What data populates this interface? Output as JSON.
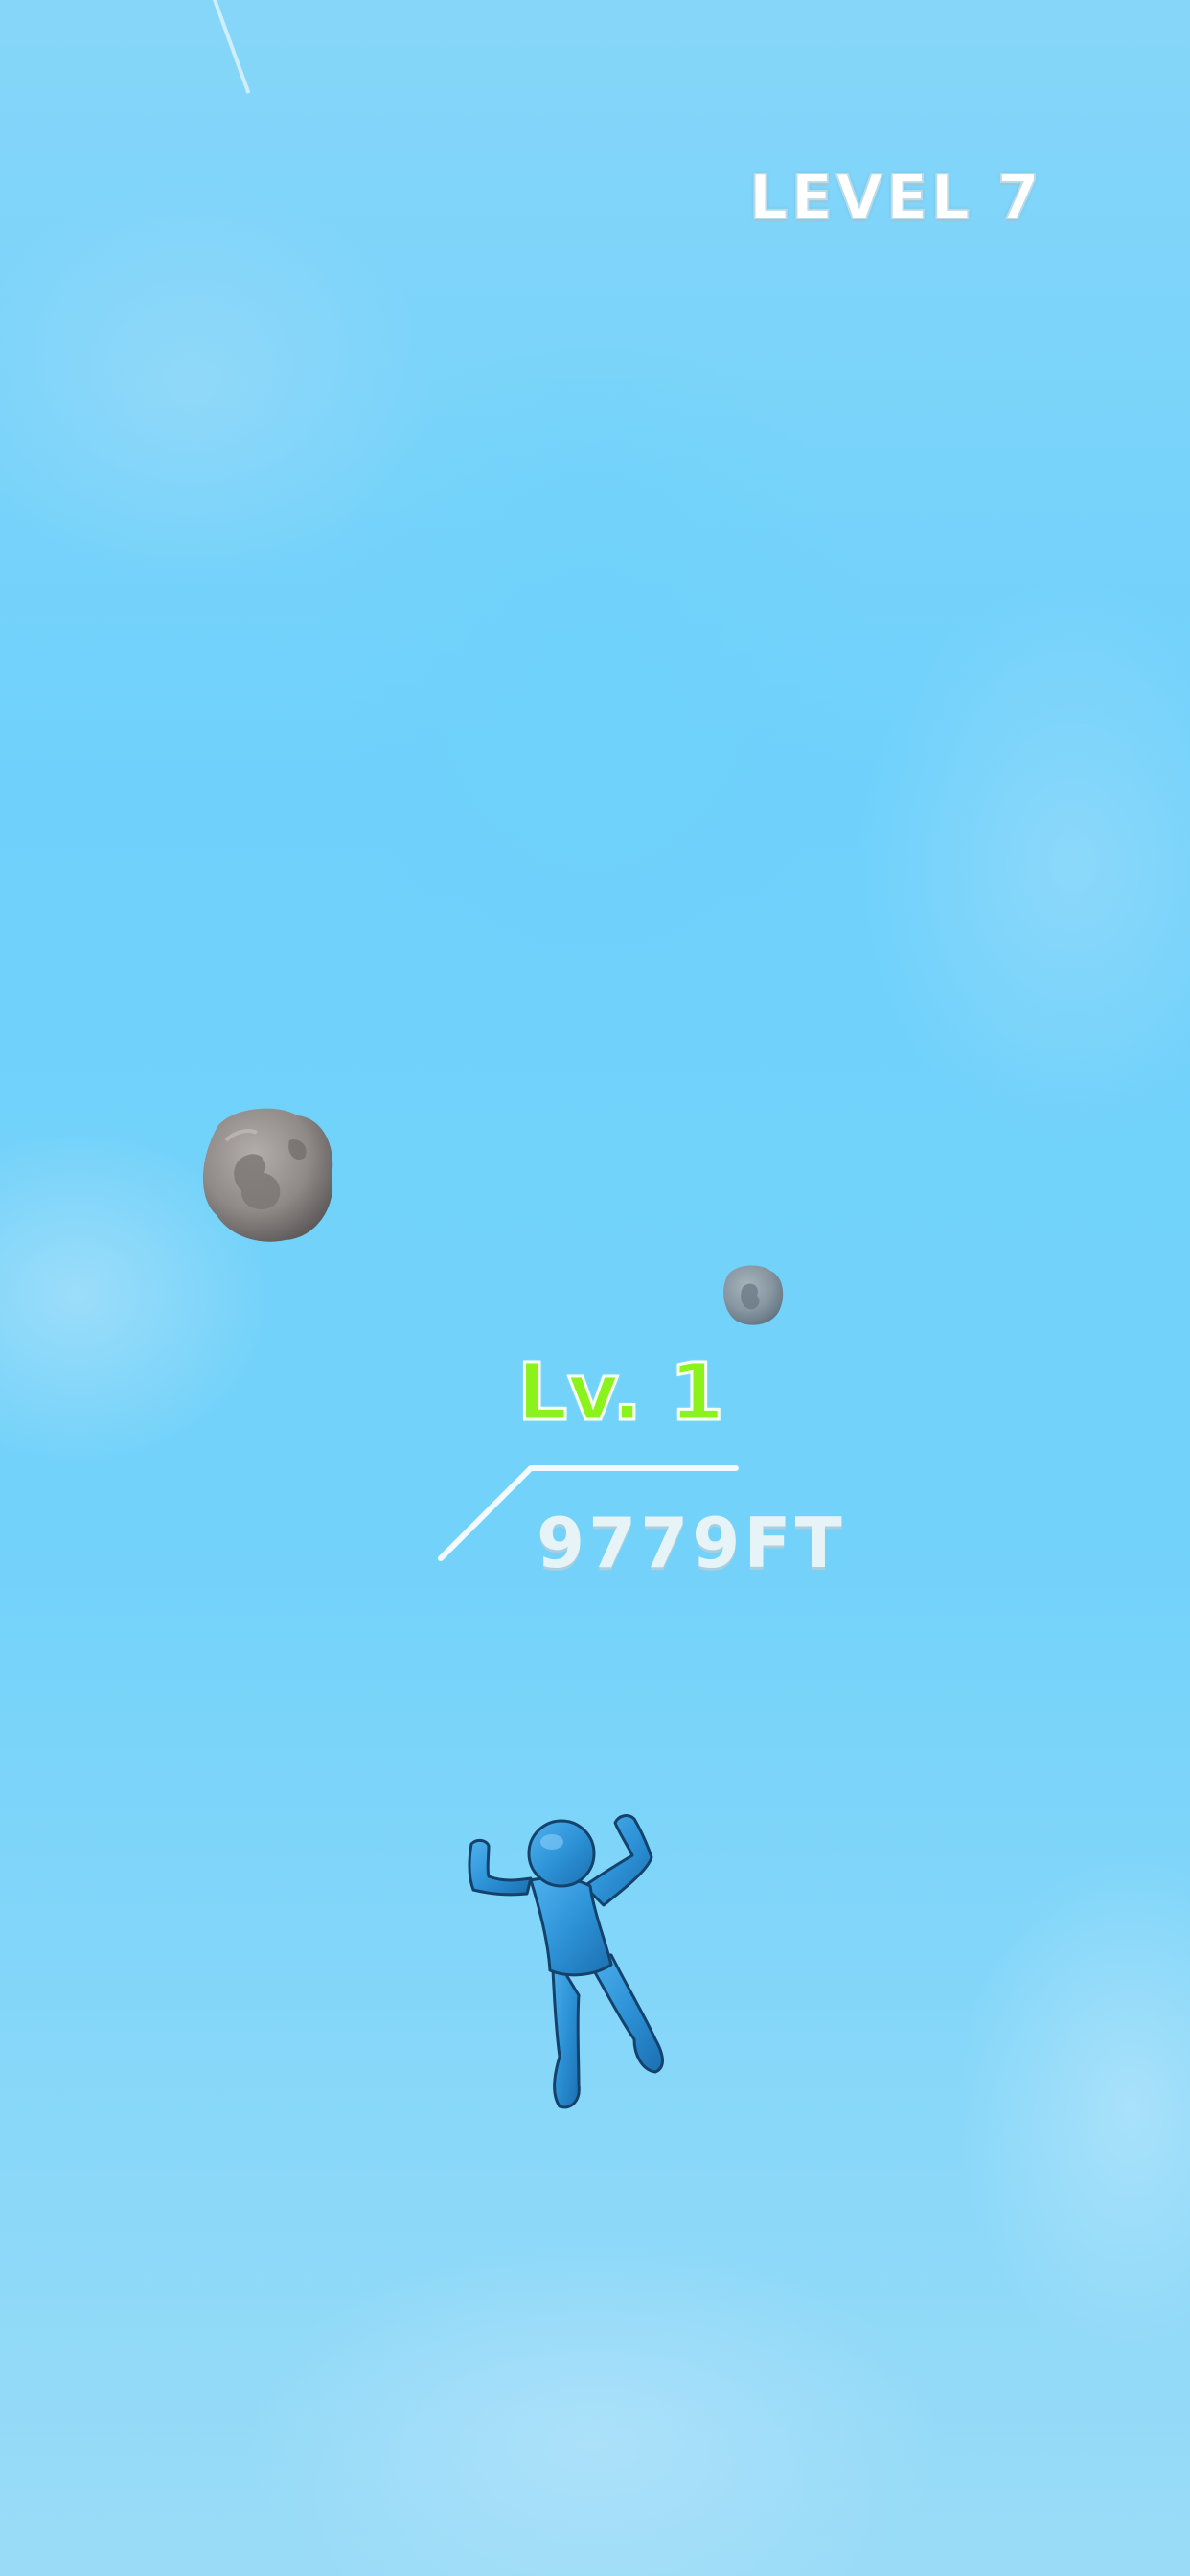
{
  "hud": {
    "level_label": "LEVEL 7"
  },
  "player": {
    "level_label": "Lv. 1",
    "distance": "9779FT"
  },
  "colors": {
    "sky": "#74d2f8",
    "player_body": "#2e93d8",
    "player_level_text": "#8bf21b",
    "rock": "#8d8a8a",
    "hud_text": "#ffffff"
  },
  "icons": {
    "player": "stickman-skydiver-icon",
    "rock": "falling-rock-icon"
  }
}
